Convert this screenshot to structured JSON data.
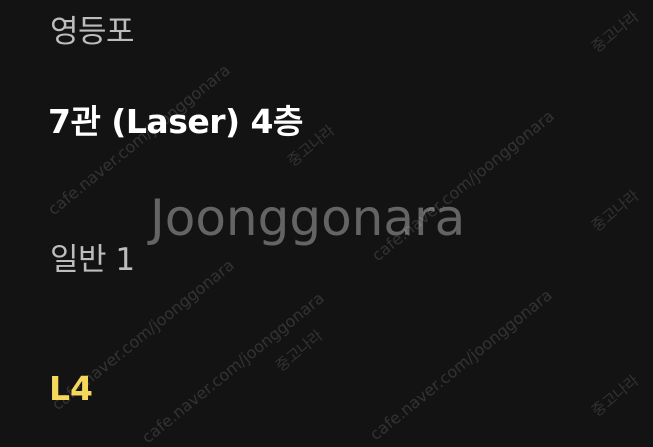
{
  "ticket": {
    "theater_name": "영등포",
    "screen_info": "7관 (Laser) 4층",
    "seat_class": "일반 1",
    "seat_number": "L4"
  },
  "watermark": {
    "logo_text": "Joonggonara",
    "url_text": "cafe.naver.com/joonggonara",
    "brand_text": "중고나라"
  },
  "colors": {
    "background": "#131313",
    "primary_text": "#ffffff",
    "secondary_text": "#bdbdbd",
    "accent": "#f5d75c"
  }
}
